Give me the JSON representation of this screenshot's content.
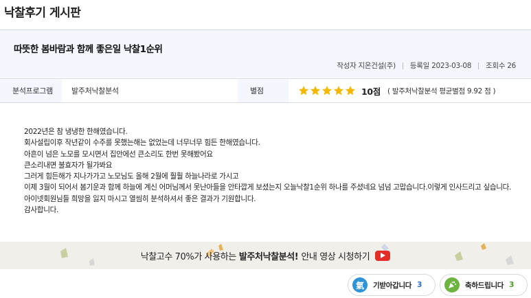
{
  "board": {
    "title": "낙찰후기 게시판"
  },
  "post": {
    "title": "따뜻한 봄바람과 함께 좋은일 낙찰1순위",
    "author_label": "작성자",
    "author": "지온건설(주)",
    "date_label": "등록일",
    "date": "2023-03-08",
    "views_label": "조회수",
    "views": "26"
  },
  "info": {
    "program_label": "분석프로그램",
    "program_value": "발주처낙찰분석",
    "score_label": "별점",
    "rating": 5,
    "rating_max": 5,
    "star_color": "#f5b800",
    "score_text": "10점",
    "score_avg": "( 발주처낙찰분석 평균별점 9.92 점 )"
  },
  "body": {
    "lines": [
      "2022년은 참 냉냉한 한해였습니다.",
      "회사설립이후 작년같이 수주를 못했는해는 없었는데 너무너무 힘든 한해였습니다.",
      "아흔이 넘은 노모를 모시면서 집안에선 큰소리도 한번 못해봤어요",
      "큰소리내면 불효자가 될가봐요",
      "그러게 힘든해가 지나가가고 노모님도 올해 2월에 훨훨 하늘나라로 가시고",
      "이제 3월이 되어서 봄기운과 함께 하늘에 계신 어머님께서 못난아들을 안타깝게 보셨는지 오늘낙찰1순위 하나를 주셨네요 넘넘 고맙습니다.이렇게 인사드리고 싶습니다.",
      "아이넷회원님들 희망을 잃지 마시고 열씸히 분석하셔서 좋은 결과가 기원합니다.",
      "감사합니다."
    ]
  },
  "banner": {
    "text_before": "낙찰고수 70%가 사용하는",
    "text_bold": "발주처낙찰분석!",
    "text_after": "안내 영상 시청하기",
    "icon": "youtube-play-icon",
    "icon_color": "#e52d27"
  },
  "reactions": {
    "cheer": {
      "icon_glyph": "氣",
      "label": "기받아갑니다",
      "count": "3",
      "color": "#2f93d8"
    },
    "congrats": {
      "icon": "party-popper-icon",
      "label": "축하드립니다",
      "count": "3",
      "color": "#6db33f"
    }
  }
}
